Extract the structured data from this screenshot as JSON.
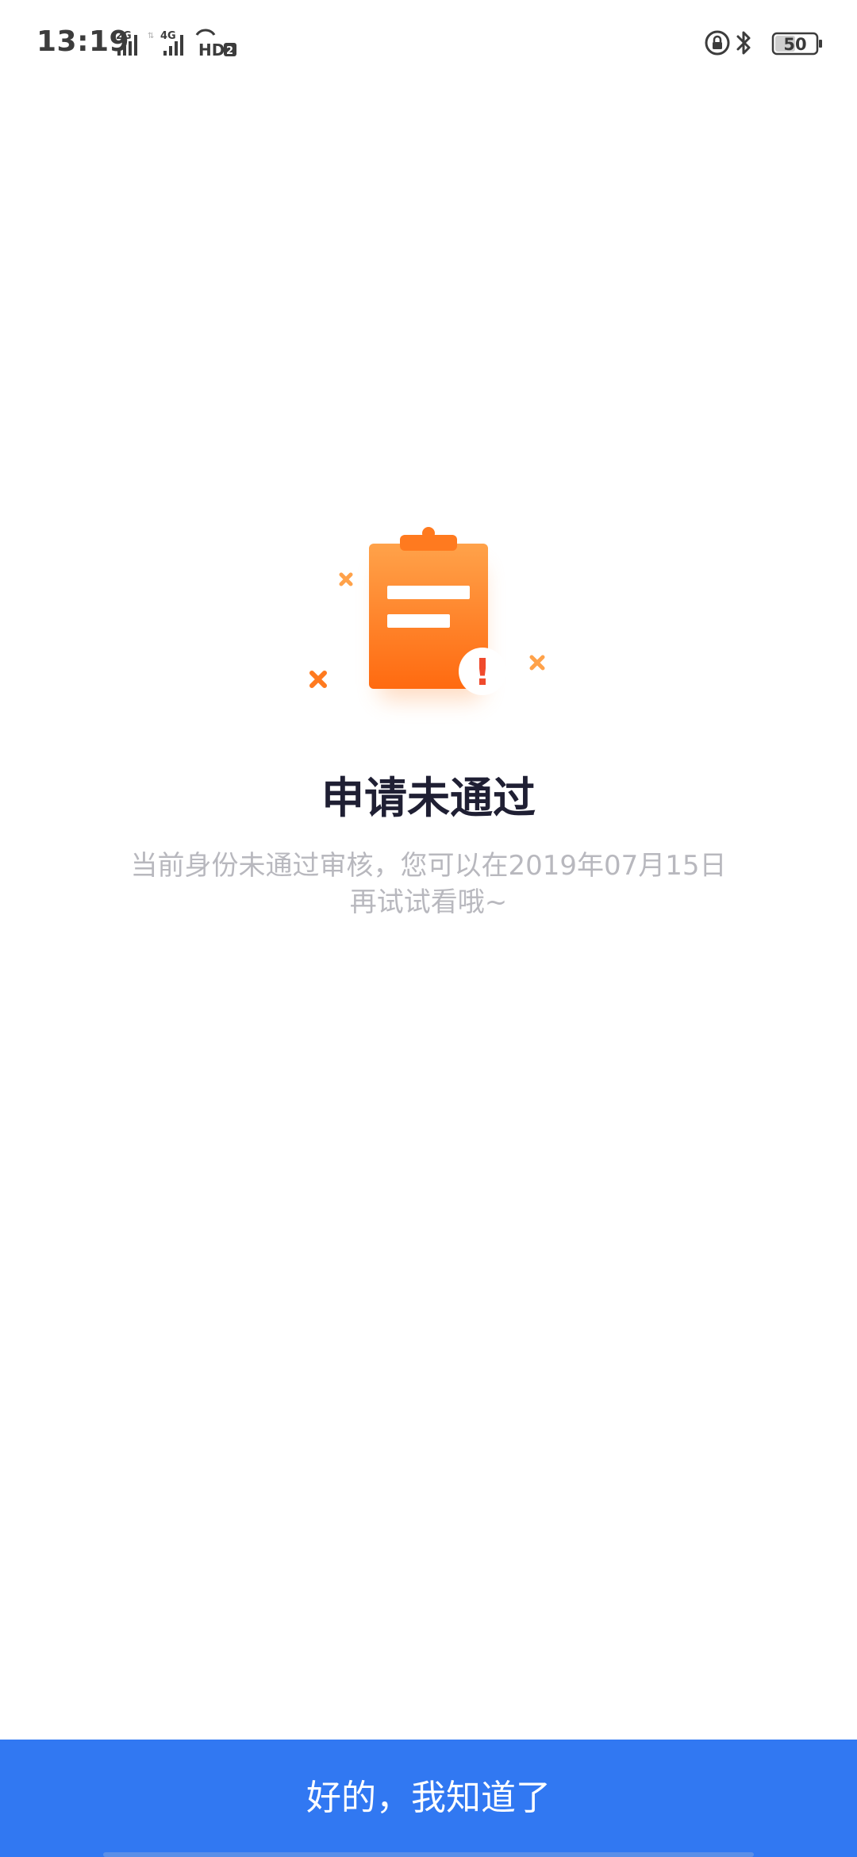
{
  "status_bar": {
    "time": "13:19",
    "net_label_1": "2G",
    "net_label_2": "4G",
    "hd_label": "HD",
    "hd_sub": "2",
    "battery_level": "50",
    "icons": [
      "signal-icon",
      "signal-icon",
      "hd-voice-icon",
      "rotation-lock-icon",
      "bluetooth-icon",
      "battery-icon"
    ]
  },
  "illustration": {
    "icon": "clipboard-warning-icon",
    "badge_text": "!",
    "colors": {
      "clipboard_top": "#ff9d3f",
      "clipboard_bottom": "#ff6a10",
      "warning_mark": "#f04a2c"
    }
  },
  "result": {
    "title": "申请未通过",
    "description_line1": "当前身份未通过审核，您可以在2019年07月15日",
    "description_line2": "再试试看哦~"
  },
  "footer": {
    "button_label": "好的，我知道了",
    "button_color": "#3178f2"
  }
}
